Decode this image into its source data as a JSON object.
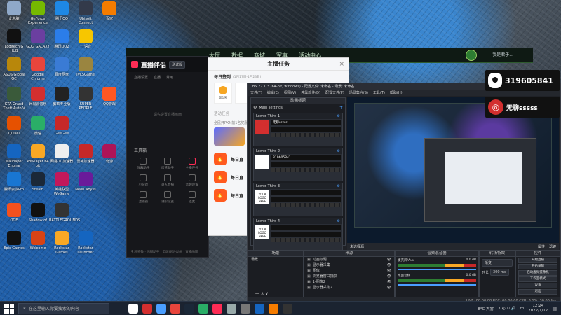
{
  "desktop": {
    "icons": [
      {
        "label": "此电脑",
        "color": "#8fa9c9"
      },
      {
        "label": "GeForce Experience",
        "color": "#76b900"
      },
      {
        "label": "腾讯QQ",
        "color": "#1e88e5"
      },
      {
        "label": "Ubisoft Connect",
        "color": "#333a4a"
      },
      {
        "label": "百家",
        "color": "#f57c00"
      },
      {
        "label": "Logitech G HUB",
        "color": "#111"
      },
      {
        "label": "GOG GALAXY",
        "color": "#6b3fa0"
      },
      {
        "label": "腾讯QQ2",
        "color": "#2b7de9"
      },
      {
        "label": "YY语音",
        "color": "#f7c600"
      },
      {
        "label": "ASUS Global OC",
        "color": "#b8870b"
      },
      {
        "label": "Google Chrome",
        "color": "#e8453c"
      },
      {
        "label": "百度网盘",
        "color": "#3a7bd5"
      },
      {
        "label": "IVLSGame",
        "color": "#9a8540"
      },
      {
        "label": "GTA Grand Theft Auto V",
        "color": "#3a5a3a"
      },
      {
        "label": "网易云音乐",
        "color": "#d32f2f"
      },
      {
        "label": "剪映专业版",
        "color": "#222"
      },
      {
        "label": "SUPER PEOPLE",
        "color": "#333"
      },
      {
        "label": "QQ游戏",
        "color": "#ff5722"
      },
      {
        "label": "Quixel",
        "color": "#e65100"
      },
      {
        "label": "微信",
        "color": "#2aae67"
      },
      {
        "label": "GeeGee",
        "color": "#c62828"
      },
      {
        "label": "Wallpaper Engine",
        "color": "#1565c0"
      },
      {
        "label": "PotPlayer 64 bit",
        "color": "#f9a825"
      },
      {
        "label": "网易UU加速器",
        "color": "#eee"
      },
      {
        "label": "雷神加速器",
        "color": "#c62828"
      },
      {
        "label": "奇游",
        "color": "#ad1457"
      },
      {
        "label": "腾讯会议Pro",
        "color": "#1976d2"
      },
      {
        "label": "Steam",
        "color": "#1b2838"
      },
      {
        "label": "英雄联盟WeGame",
        "color": "#c2185b"
      },
      {
        "label": "Neon Abyss",
        "color": "#6a1b9a"
      },
      {
        "label": "OGE",
        "color": "#f4511e"
      },
      {
        "label": "Shadow of",
        "color": "#111"
      },
      {
        "label": "BATTLEGROUNDS",
        "color": "#333"
      },
      {
        "label": "Epic Games",
        "color": "#111"
      },
      {
        "label": "Welcome",
        "color": "#d84315"
      },
      {
        "label": "Rockstar Games",
        "color": "#f9a825"
      },
      {
        "label": "Rockstar Launcher",
        "color": "#1565c0"
      }
    ]
  },
  "game_client": {
    "nav": [
      "大厅",
      "数据",
      "商城",
      "军事",
      "活动中心"
    ],
    "user_badge": "我是君子..."
  },
  "live_app": {
    "brand": "直播伴侣",
    "version": "测试版",
    "tabs": [
      "直播设置",
      "直播",
      "常用"
    ],
    "empty_hint": "请先设置直播画面",
    "tools_title": "工具箱",
    "tools": [
      "弹幕助手",
      "房管助手",
      "主播任务",
      "小游戏",
      "录入直播",
      "音频设置",
      "滤镜器",
      "进阶设置",
      "连麦"
    ],
    "footer": "礼物特效 · 鸿图助手 · 全屏录制·动画 · 直播画面"
  },
  "task_dialog": {
    "title": "主播任务",
    "tab": "每日签到",
    "date_range": "(1月17日-1月23日)",
    "day": "第1天",
    "section": "活动任务",
    "event_text": "全民开PK!(前1名奖励)",
    "tasks": [
      {
        "title": "每日直"
      },
      {
        "title": "每日直"
      },
      {
        "title": "每日直"
      }
    ]
  },
  "obs": {
    "title": "OBS 27.1.3 (64-bit, windows) - 配置文件: 未命名 - 场景: 未命名",
    "menu": [
      "文件(F)",
      "编辑(E)",
      "视图(V)",
      "停靠部件(D)",
      "配置文件(P)",
      "场景集合(S)",
      "工具(T)",
      "帮助(H)"
    ],
    "dock_title": "动画标题",
    "main_settings": "Main settings",
    "lower_thirds": [
      {
        "name": "Lower Third 1",
        "text": "无聊sssss",
        "logo": "网易云音乐"
      },
      {
        "name": "Lower Third 2",
        "text": "319605841",
        "logo": "QQ"
      },
      {
        "name": "Lower Third 3",
        "logo_text": "YOUR LOGO HERE"
      },
      {
        "name": "Lower Third 4",
        "logo_text": "YOUR LOGO HERE"
      }
    ],
    "scenes_title": "场景",
    "scenes": [
      "场景"
    ],
    "sources_title": "来源",
    "sources": [
      "动画标题",
      "显示器采集",
      "图像",
      "浏览器窗口捕获",
      "1-图像2",
      "显示器采集2"
    ],
    "mixer_title": "音频混音器",
    "mixer": [
      {
        "name": "麦克风/Aux",
        "db": "0.0 dB"
      },
      {
        "name": "桌面音频",
        "db": "0.0 dB"
      }
    ],
    "transitions_title": "转场特效",
    "transition": "渐变",
    "duration_label": "时长",
    "duration": "300 ms",
    "controls_title": "控件",
    "controls": [
      "开始直播",
      "开始录制",
      "启动虚拟摄像机",
      "工作室模式",
      "设置",
      "退出"
    ],
    "no_source": "未选择源",
    "props": "属性",
    "filters": "滤镜",
    "status": "LIVE: 00:00:00   REC: 00:00:00   CPU: 3.1%, 30.00 fps"
  },
  "overlay": {
    "qq_number": "319605841",
    "netease_text": "无聊sssss"
  },
  "taskbar": {
    "search_placeholder": "在这里输入你要搜索的内容",
    "weather": "8°C 大雾",
    "time": "12:24",
    "date": "2022/1/17",
    "lang": "中"
  }
}
